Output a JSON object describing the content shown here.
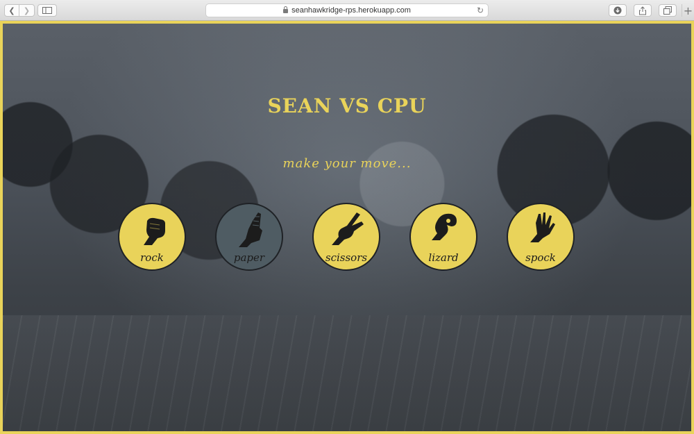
{
  "browser": {
    "url": "seanhawkridge-rps.herokuapp.com"
  },
  "game": {
    "title": "SEAN VS CPU",
    "subtitle": "make your move...",
    "moves": [
      {
        "label": "rock",
        "icon": "rock-hand-icon",
        "selected": false
      },
      {
        "label": "paper",
        "icon": "paper-hand-icon",
        "selected": true
      },
      {
        "label": "scissors",
        "icon": "scissors-hand-icon",
        "selected": false
      },
      {
        "label": "lizard",
        "icon": "lizard-hand-icon",
        "selected": false
      },
      {
        "label": "spock",
        "icon": "spock-hand-icon",
        "selected": false
      }
    ]
  },
  "colors": {
    "accent": "#e9d35a",
    "selected": "#4f5c63",
    "icon": "#1c1c1c"
  }
}
